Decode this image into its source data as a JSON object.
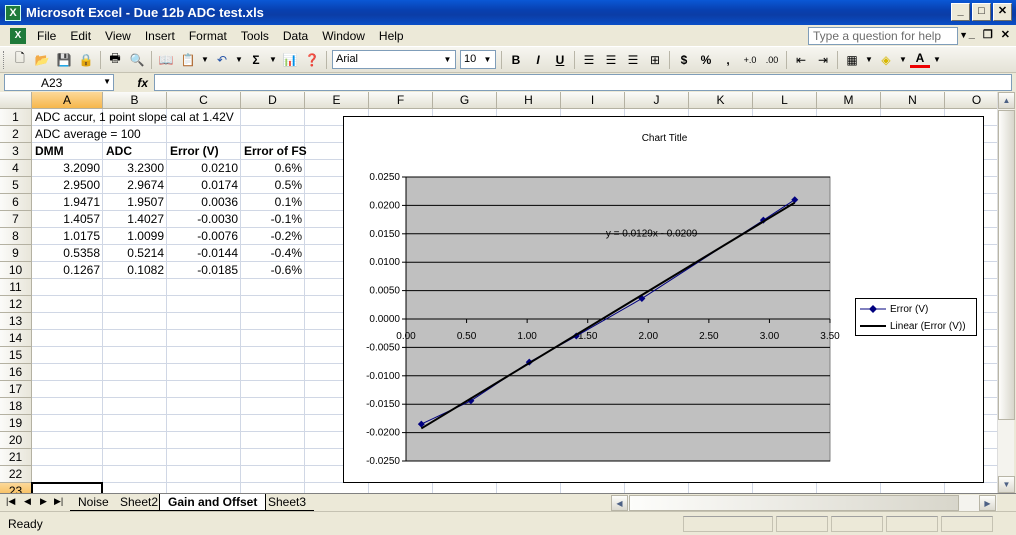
{
  "window": {
    "title": "Microsoft Excel - Due 12b ADC test.xls",
    "app_icon": "excel-icon"
  },
  "menu": {
    "items": [
      "File",
      "Edit",
      "View",
      "Insert",
      "Format",
      "Tools",
      "Data",
      "Window",
      "Help"
    ],
    "help_placeholder": "Type a question for help"
  },
  "toolbar": {
    "font": "Arial",
    "size": "10",
    "bold": "B",
    "italic": "I",
    "underline": "U",
    "currency": "$",
    "percent": "%",
    "autosum": "Σ"
  },
  "formula_bar": {
    "name_box": "A23",
    "fx_label": "fx",
    "formula": ""
  },
  "columns": [
    "A",
    "B",
    "C",
    "D",
    "E",
    "F",
    "G",
    "H",
    "I",
    "J",
    "K",
    "L",
    "M",
    "N",
    "O"
  ],
  "rows": [
    "1",
    "2",
    "3",
    "4",
    "5",
    "6",
    "7",
    "8",
    "9",
    "10",
    "11",
    "12",
    "13",
    "14",
    "15",
    "16",
    "17",
    "18",
    "19",
    "20",
    "21",
    "22",
    "23"
  ],
  "sheet": {
    "A1": "ADC accur, 1 point slope cal at 1.42V",
    "A2": "ADC average = 100",
    "headers": [
      "DMM",
      "ADC",
      "Error (V)",
      "Error of FS"
    ],
    "table": [
      [
        "3.2090",
        "3.2300",
        "0.0210",
        "0.6%"
      ],
      [
        "2.9500",
        "2.9674",
        "0.0174",
        "0.5%"
      ],
      [
        "1.9471",
        "1.9507",
        "0.0036",
        "0.1%"
      ],
      [
        "1.4057",
        "1.4027",
        "-0.0030",
        "-0.1%"
      ],
      [
        "1.0175",
        "1.0099",
        "-0.0076",
        "-0.2%"
      ],
      [
        "0.5358",
        "0.5214",
        "-0.0144",
        "-0.4%"
      ],
      [
        "0.1267",
        "0.1082",
        "-0.0185",
        "-0.6%"
      ]
    ]
  },
  "chart_data": {
    "type": "scatter",
    "title": "Chart Title",
    "series": [
      {
        "name": "Error (V)",
        "x": [
          3.209,
          2.95,
          1.9471,
          1.4057,
          1.0175,
          0.5358,
          0.1267
        ],
        "y": [
          0.021,
          0.0174,
          0.0036,
          -0.003,
          -0.0076,
          -0.0144,
          -0.0185
        ],
        "color": "#00007f"
      },
      {
        "name": "Linear (Error (V))",
        "trend": {
          "slope": 0.0129,
          "intercept": -0.0209
        },
        "color": "#000000"
      }
    ],
    "equation_label": "y = 0.0129x - 0.0209",
    "xlim": [
      0,
      3.5
    ],
    "ylim": [
      -0.025,
      0.025
    ],
    "x_ticks": [
      "0.00",
      "0.50",
      "1.00",
      "1.50",
      "2.00",
      "2.50",
      "3.00",
      "3.50"
    ],
    "y_ticks": [
      "0.0250",
      "0.0200",
      "0.0150",
      "0.0100",
      "0.0050",
      "0.0000",
      "-0.0050",
      "-0.0100",
      "-0.0150",
      "-0.0200",
      "-0.0250"
    ],
    "plot_background": "#c0c0c0",
    "grid": true,
    "legend_position": "right"
  },
  "tabs": [
    "Noise",
    "Sheet2",
    "Gain and Offset",
    "Sheet3"
  ],
  "active_tab": "Gain and Offset",
  "status": {
    "text": "Ready"
  },
  "colors": {
    "title_bar": "#0a4ec7",
    "chart_marker": "#00007f",
    "selected_header": "#f6b74c"
  }
}
